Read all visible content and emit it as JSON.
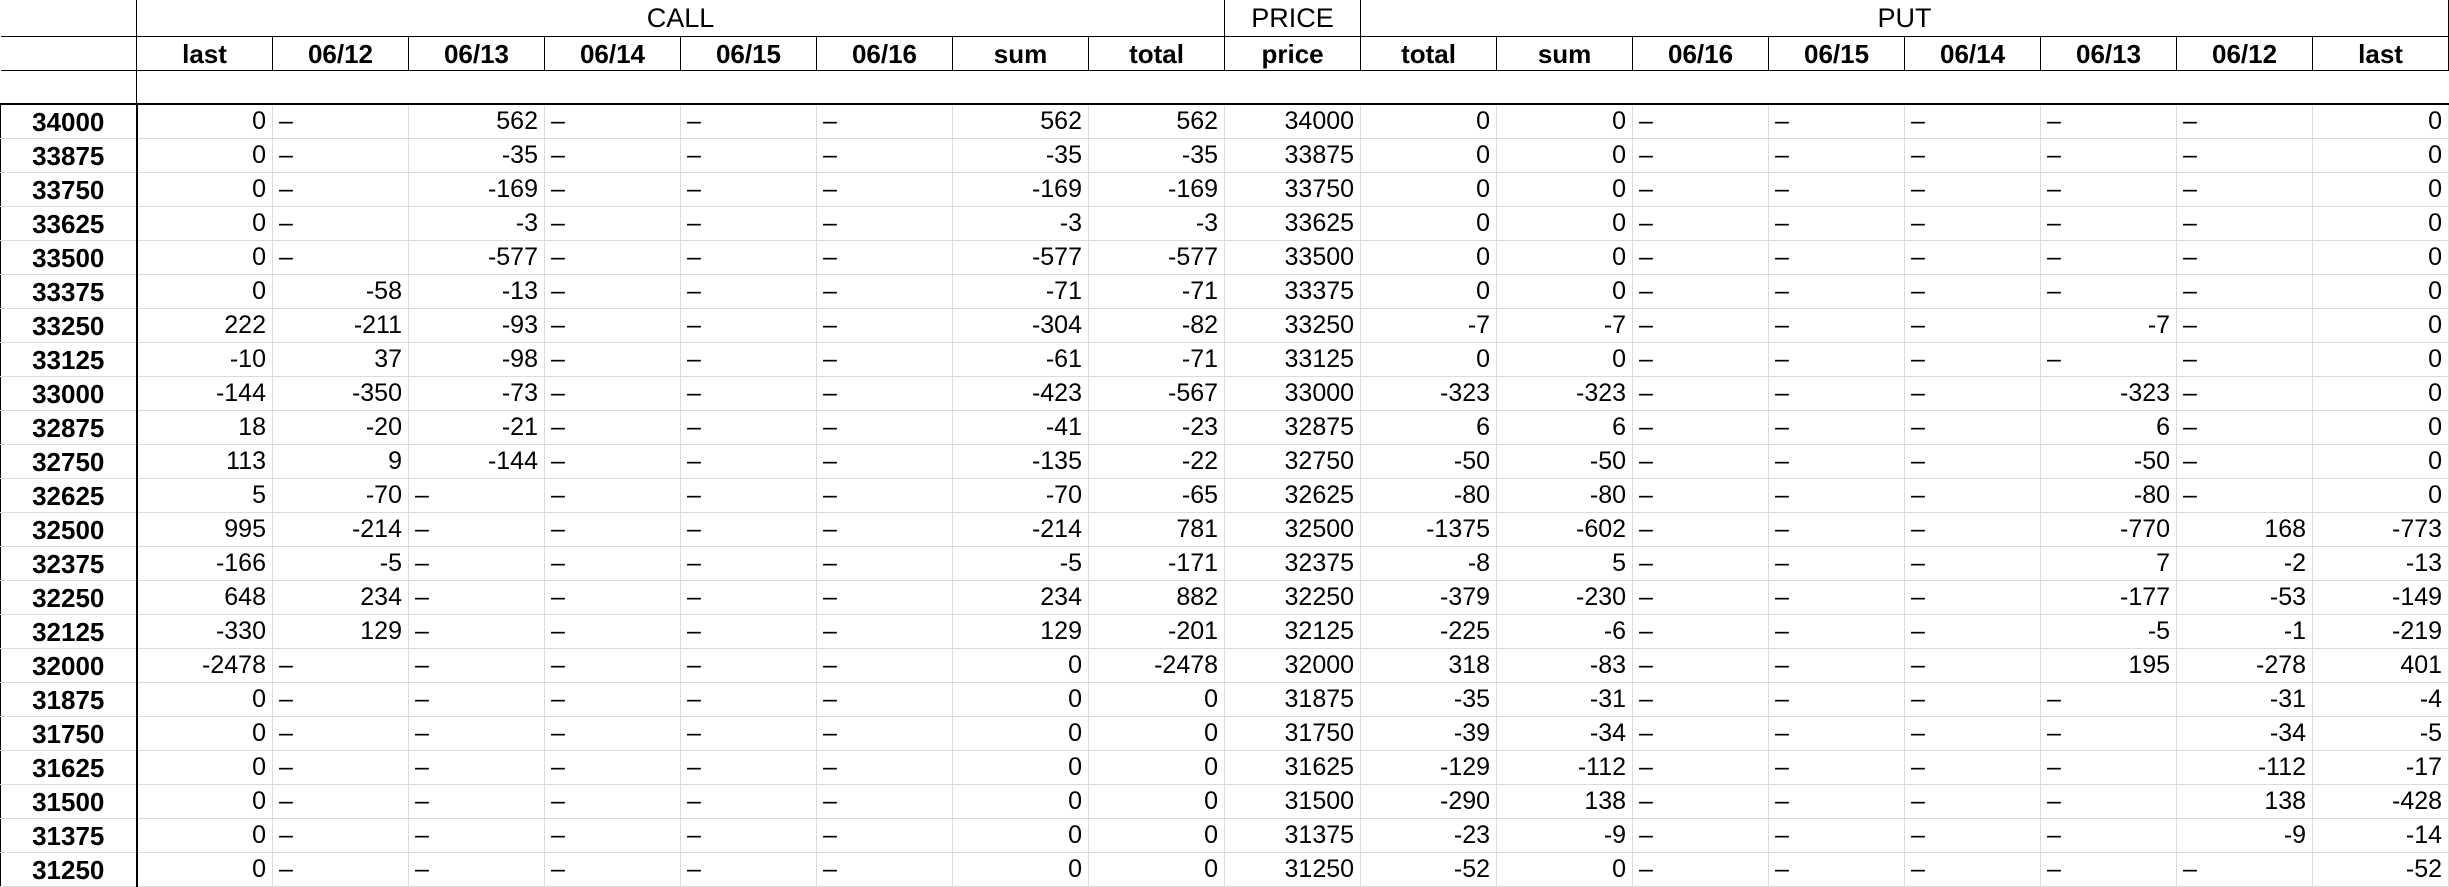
{
  "groups": {
    "call": "CALL",
    "price": "PRICE",
    "put": "PUT"
  },
  "columns": [
    "last",
    "06/12",
    "06/13",
    "06/14",
    "06/15",
    "06/16",
    "sum",
    "total",
    "price",
    "total",
    "sum",
    "06/16",
    "06/15",
    "06/14",
    "06/13",
    "06/12",
    "last"
  ],
  "rows": [
    {
      "label": "34000",
      "cells": [
        "0",
        "–",
        "562",
        "–",
        "–",
        "–",
        "562",
        "562",
        "34000",
        "0",
        "0",
        "–",
        "–",
        "–",
        "–",
        "–",
        "0"
      ]
    },
    {
      "label": "33875",
      "cells": [
        "0",
        "–",
        "-35",
        "–",
        "–",
        "–",
        "-35",
        "-35",
        "33875",
        "0",
        "0",
        "–",
        "–",
        "–",
        "–",
        "–",
        "0"
      ]
    },
    {
      "label": "33750",
      "cells": [
        "0",
        "–",
        "-169",
        "–",
        "–",
        "–",
        "-169",
        "-169",
        "33750",
        "0",
        "0",
        "–",
        "–",
        "–",
        "–",
        "–",
        "0"
      ]
    },
    {
      "label": "33625",
      "cells": [
        "0",
        "–",
        "-3",
        "–",
        "–",
        "–",
        "-3",
        "-3",
        "33625",
        "0",
        "0",
        "–",
        "–",
        "–",
        "–",
        "–",
        "0"
      ]
    },
    {
      "label": "33500",
      "cells": [
        "0",
        "–",
        "-577",
        "–",
        "–",
        "–",
        "-577",
        "-577",
        "33500",
        "0",
        "0",
        "–",
        "–",
        "–",
        "–",
        "–",
        "0"
      ]
    },
    {
      "label": "33375",
      "cells": [
        "0",
        "-58",
        "-13",
        "–",
        "–",
        "–",
        "-71",
        "-71",
        "33375",
        "0",
        "0",
        "–",
        "–",
        "–",
        "–",
        "–",
        "0"
      ]
    },
    {
      "label": "33250",
      "cells": [
        "222",
        "-211",
        "-93",
        "–",
        "–",
        "–",
        "-304",
        "-82",
        "33250",
        "-7",
        "-7",
        "–",
        "–",
        "–",
        "-7",
        "–",
        "0"
      ]
    },
    {
      "label": "33125",
      "cells": [
        "-10",
        "37",
        "-98",
        "–",
        "–",
        "–",
        "-61",
        "-71",
        "33125",
        "0",
        "0",
        "–",
        "–",
        "–",
        "–",
        "–",
        "0"
      ]
    },
    {
      "label": "33000",
      "cells": [
        "-144",
        "-350",
        "-73",
        "–",
        "–",
        "–",
        "-423",
        "-567",
        "33000",
        "-323",
        "-323",
        "–",
        "–",
        "–",
        "-323",
        "–",
        "0"
      ]
    },
    {
      "label": "32875",
      "cells": [
        "18",
        "-20",
        "-21",
        "–",
        "–",
        "–",
        "-41",
        "-23",
        "32875",
        "6",
        "6",
        "–",
        "–",
        "–",
        "6",
        "–",
        "0"
      ]
    },
    {
      "label": "32750",
      "cells": [
        "113",
        "9",
        "-144",
        "–",
        "–",
        "–",
        "-135",
        "-22",
        "32750",
        "-50",
        "-50",
        "–",
        "–",
        "–",
        "-50",
        "–",
        "0"
      ]
    },
    {
      "label": "32625",
      "cells": [
        "5",
        "-70",
        "–",
        "–",
        "–",
        "–",
        "-70",
        "-65",
        "32625",
        "-80",
        "-80",
        "–",
        "–",
        "–",
        "-80",
        "–",
        "0"
      ]
    },
    {
      "label": "32500",
      "cells": [
        "995",
        "-214",
        "–",
        "–",
        "–",
        "–",
        "-214",
        "781",
        "32500",
        "-1375",
        "-602",
        "–",
        "–",
        "–",
        "-770",
        "168",
        "-773"
      ]
    },
    {
      "label": "32375",
      "cells": [
        "-166",
        "-5",
        "–",
        "–",
        "–",
        "–",
        "-5",
        "-171",
        "32375",
        "-8",
        "5",
        "–",
        "–",
        "–",
        "7",
        "-2",
        "-13"
      ]
    },
    {
      "label": "32250",
      "cells": [
        "648",
        "234",
        "–",
        "–",
        "–",
        "–",
        "234",
        "882",
        "32250",
        "-379",
        "-230",
        "–",
        "–",
        "–",
        "-177",
        "-53",
        "-149"
      ]
    },
    {
      "label": "32125",
      "cells": [
        "-330",
        "129",
        "–",
        "–",
        "–",
        "–",
        "129",
        "-201",
        "32125",
        "-225",
        "-6",
        "–",
        "–",
        "–",
        "-5",
        "-1",
        "-219"
      ]
    },
    {
      "label": "32000",
      "cells": [
        "-2478",
        "–",
        "–",
        "–",
        "–",
        "–",
        "0",
        "-2478",
        "32000",
        "318",
        "-83",
        "–",
        "–",
        "–",
        "195",
        "-278",
        "401"
      ]
    },
    {
      "label": "31875",
      "cells": [
        "0",
        "–",
        "–",
        "–",
        "–",
        "–",
        "0",
        "0",
        "31875",
        "-35",
        "-31",
        "–",
        "–",
        "–",
        "–",
        "-31",
        "-4"
      ]
    },
    {
      "label": "31750",
      "cells": [
        "0",
        "–",
        "–",
        "–",
        "–",
        "–",
        "0",
        "0",
        "31750",
        "-39",
        "-34",
        "–",
        "–",
        "–",
        "–",
        "-34",
        "-5"
      ]
    },
    {
      "label": "31625",
      "cells": [
        "0",
        "–",
        "–",
        "–",
        "–",
        "–",
        "0",
        "0",
        "31625",
        "-129",
        "-112",
        "–",
        "–",
        "–",
        "–",
        "-112",
        "-17"
      ]
    },
    {
      "label": "31500",
      "cells": [
        "0",
        "–",
        "–",
        "–",
        "–",
        "–",
        "0",
        "0",
        "31500",
        "-290",
        "138",
        "–",
        "–",
        "–",
        "–",
        "138",
        "-428"
      ]
    },
    {
      "label": "31375",
      "cells": [
        "0",
        "–",
        "–",
        "–",
        "–",
        "–",
        "0",
        "0",
        "31375",
        "-23",
        "-9",
        "–",
        "–",
        "–",
        "–",
        "-9",
        "-14"
      ]
    },
    {
      "label": "31250",
      "cells": [
        "0",
        "–",
        "–",
        "–",
        "–",
        "–",
        "0",
        "0",
        "31250",
        "-52",
        "0",
        "–",
        "–",
        "–",
        "–",
        "–",
        "-52"
      ]
    }
  ]
}
